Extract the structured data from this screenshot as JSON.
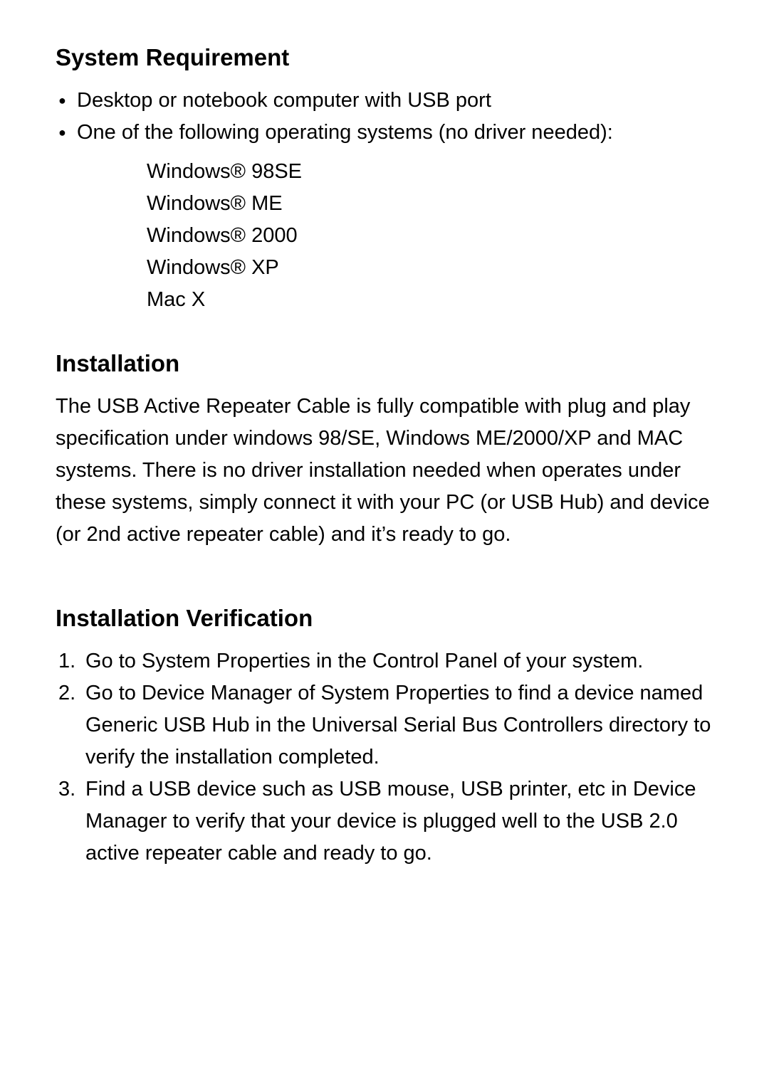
{
  "sections": {
    "sysreq": {
      "heading": "System Requirement",
      "bullets": [
        "Desktop or notebook computer with USB port",
        "One of the following operating systems (no driver needed):"
      ],
      "os_list": [
        "Windows® 98SE",
        "Windows® ME",
        "Windows® 2000",
        "Windows® XP",
        "Mac X"
      ]
    },
    "install": {
      "heading": "Installation",
      "paragraph": "The USB Active Repeater Cable is fully compatible with plug and play specification under windows 98/SE, Windows ME/2000/XP and MAC systems. There is no driver installation needed when operates under these systems, simply connect it with your PC (or USB Hub) and device (or 2nd active repeater cable) and it’s ready to go."
    },
    "verify": {
      "heading": "Installation Verification",
      "steps": [
        "Go to System Properties in the Control Panel of your system.",
        "Go to Device Manager of System Properties to find a device named Generic USB Hub in the Universal Serial Bus Controllers directory to verify the installation completed.",
        "Find a USB device such as USB mouse, USB printer, etc in Device Manager to verify that your device is plugged well to the USB 2.0 active repeater cable and ready to go."
      ]
    }
  }
}
